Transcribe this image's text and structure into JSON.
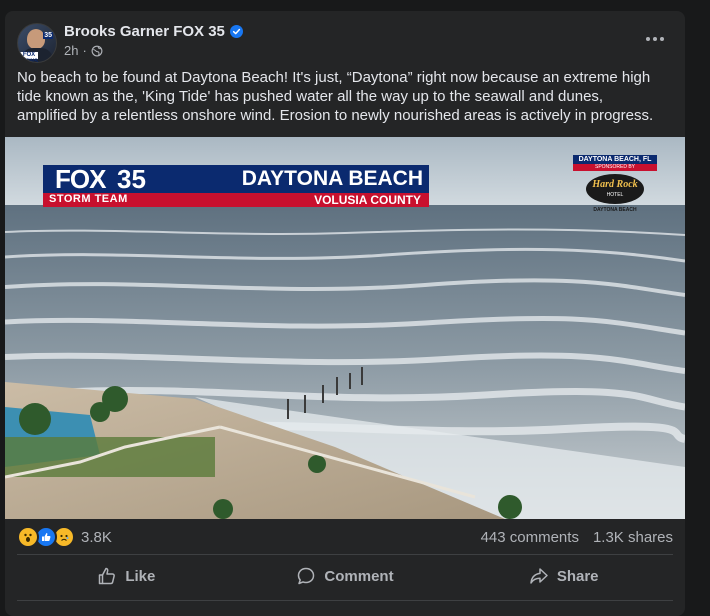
{
  "post": {
    "author": "Brooks Garner FOX 35",
    "time": "2h",
    "text": "No beach to be found at Daytona Beach! It's just, “Daytona” right now because an extreme high tide known as the, 'King Tide' has pushed water all the way up to the seawall and dunes, amplified by a relentless onshore wind. Erosion to newly nourished areas is actively in progress.",
    "avatar": {
      "tag": "FOX NEWS",
      "badge": "35"
    }
  },
  "media": {
    "logo_fox": "FOX",
    "logo_35": "35",
    "logo_team": "STORM TEAM",
    "headline": "DAYTONA BEACH",
    "subhead": "VOLUSIA COUNTY",
    "corner_top": "DAYTONA BEACH, FL",
    "corner_sponsor": "SPONSORED BY",
    "corner_brand": "Hard Rock",
    "corner_hotel": "HOTEL",
    "corner_bottom": "DAYTONA BEACH"
  },
  "stats": {
    "reaction_count": "3.8K",
    "comments": "443 comments",
    "shares": "1.3K shares"
  },
  "actions": {
    "like": "Like",
    "comment": "Comment",
    "share": "Share"
  },
  "colors": {
    "background": "#18191a",
    "card": "#242526",
    "text": "#e4e6eb",
    "muted": "#b0b3b8",
    "accent": "#1877f2",
    "fox_blue": "#0b2a6f",
    "fox_red": "#c8102e"
  },
  "icons": {
    "verified": "verified-badge-icon",
    "privacy": "globe-icon",
    "more": "more-options-icon",
    "like": "thumbs-up-icon",
    "comment": "speech-bubble-icon",
    "share": "share-arrow-icon"
  }
}
